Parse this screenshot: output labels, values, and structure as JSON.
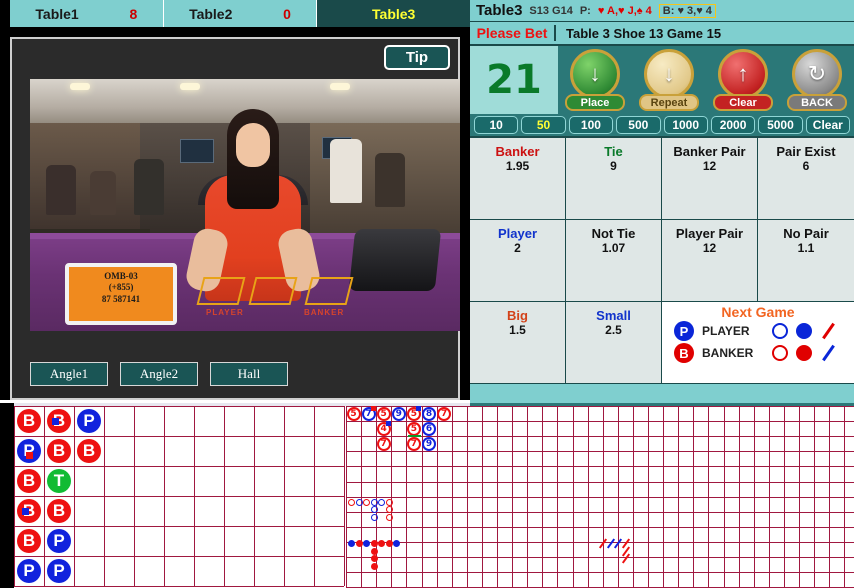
{
  "tabs": [
    {
      "label": "Table1",
      "count": "8",
      "active": false
    },
    {
      "label": "Table2",
      "count": "0",
      "active": false
    },
    {
      "label": "Table3",
      "count": "",
      "active": true
    }
  ],
  "video": {
    "tip_label": "Tip",
    "sign_line1": "OMB-03",
    "sign_line2": "(+855)",
    "sign_line3": "87 587141",
    "label_player": "PLAYER",
    "label_banker": "BANKER",
    "buttons": [
      {
        "label": "Angle1"
      },
      {
        "label": "Angle2"
      },
      {
        "label": "Hall"
      }
    ]
  },
  "header": {
    "title": "Table3",
    "shoe_game": "S13 G14",
    "player_cards_label": "P:",
    "player_cards": "♥ A,♥ J,♠ 4",
    "banker_cards": "B: ♥ 3,♥ 4",
    "status": "Please Bet",
    "game_info": "Table 3  Shoe 13  Game 15"
  },
  "action": {
    "countdown": "21",
    "buttons": [
      {
        "label": "Place",
        "icon": "down-arrow-chip-icon",
        "color": "#2f8a34"
      },
      {
        "label": "Repeat",
        "icon": "repeat-chip-icon",
        "color": "#e0c585"
      },
      {
        "label": "Clear",
        "icon": "up-arrow-chip-icon",
        "color": "#c32222"
      },
      {
        "label": "BACK",
        "icon": "refresh-icon",
        "color": "#7a7a7a"
      }
    ]
  },
  "chips": {
    "selected": "50",
    "values": [
      "10",
      "50",
      "100",
      "500",
      "1000",
      "2000",
      "5000",
      "Clear"
    ]
  },
  "bets": [
    {
      "name": "Banker",
      "odds": "1.95",
      "color_class": "c-banker"
    },
    {
      "name": "Tie",
      "odds": "9",
      "color_class": "c-tie"
    },
    {
      "name": "Banker Pair",
      "odds": "12",
      "color_class": "c-dark"
    },
    {
      "name": "Pair Exist",
      "odds": "6",
      "color_class": "c-dark"
    },
    {
      "name": "Player",
      "odds": "2",
      "color_class": "c-player"
    },
    {
      "name": "Not Tie",
      "odds": "1.07",
      "color_class": "c-dark"
    },
    {
      "name": "Player Pair",
      "odds": "12",
      "color_class": "c-dark"
    },
    {
      "name": "No Pair",
      "odds": "1.1",
      "color_class": "c-dark"
    },
    {
      "name": "Big",
      "odds": "1.5",
      "color_class": "c-big"
    },
    {
      "name": "Small",
      "odds": "2.5",
      "color_class": "c-small"
    }
  ],
  "next_game": {
    "title": "Next Game",
    "rows": [
      {
        "bead": "P",
        "name": "PLAYER",
        "ring": "blue",
        "dot": "blue",
        "slash": "red"
      },
      {
        "bead": "B",
        "name": "BANKER",
        "ring": "red",
        "dot": "red",
        "slash": "blue"
      }
    ]
  },
  "roads": {
    "bead_plate": {
      "cols": 6,
      "rows": 6,
      "cell": 30,
      "entries": [
        {
          "c": 0,
          "r": 0,
          "v": "B"
        },
        {
          "c": 1,
          "r": 0,
          "v": "B",
          "pair": "blue"
        },
        {
          "c": 2,
          "r": 0,
          "v": "P"
        },
        {
          "c": 0,
          "r": 1,
          "v": "P",
          "pair": "red"
        },
        {
          "c": 1,
          "r": 1,
          "v": "B"
        },
        {
          "c": 2,
          "r": 1,
          "v": "B"
        },
        {
          "c": 0,
          "r": 2,
          "v": "B"
        },
        {
          "c": 1,
          "r": 2,
          "v": "T"
        },
        {
          "c": 0,
          "r": 3,
          "v": "B",
          "pair": "blue"
        },
        {
          "c": 1,
          "r": 3,
          "v": "B"
        },
        {
          "c": 0,
          "r": 4,
          "v": "B"
        },
        {
          "c": 1,
          "r": 4,
          "v": "P"
        },
        {
          "c": 0,
          "r": 5,
          "v": "P"
        },
        {
          "c": 1,
          "r": 5,
          "v": "P"
        }
      ]
    },
    "big_road": {
      "entries": [
        {
          "c": 0,
          "r": 0,
          "v": "5",
          "side": "red"
        },
        {
          "c": 1,
          "r": 0,
          "v": "7",
          "side": "blue",
          "pair": "red"
        },
        {
          "c": 2,
          "r": 0,
          "v": "5",
          "side": "red"
        },
        {
          "c": 2,
          "r": 1,
          "v": "4",
          "side": "red",
          "pair": "blue"
        },
        {
          "c": 2,
          "r": 2,
          "v": "7",
          "side": "red"
        },
        {
          "c": 3,
          "r": 0,
          "v": "9",
          "side": "blue"
        },
        {
          "c": 4,
          "r": 0,
          "v": "5",
          "side": "red",
          "pair": "blue"
        },
        {
          "c": 4,
          "r": 1,
          "v": "5",
          "side": "red",
          "tie": true
        },
        {
          "c": 4,
          "r": 2,
          "v": "7",
          "side": "red"
        },
        {
          "c": 5,
          "r": 0,
          "v": "8",
          "side": "blue"
        },
        {
          "c": 5,
          "r": 1,
          "v": "6",
          "side": "blue"
        },
        {
          "c": 5,
          "r": 2,
          "v": "9",
          "side": "blue"
        },
        {
          "c": 6,
          "r": 0,
          "v": "7",
          "side": "red"
        }
      ]
    },
    "big_eye_boy": {
      "entries": [
        {
          "c": 0,
          "r": 0,
          "side": "red"
        },
        {
          "c": 1,
          "r": 0,
          "side": "blue"
        },
        {
          "c": 2,
          "r": 0,
          "side": "red"
        },
        {
          "c": 3,
          "r": 0,
          "side": "blue"
        },
        {
          "c": 3,
          "r": 1,
          "side": "blue"
        },
        {
          "c": 3,
          "r": 2,
          "side": "blue"
        },
        {
          "c": 4,
          "r": 0,
          "side": "blue"
        },
        {
          "c": 5,
          "r": 0,
          "side": "red"
        },
        {
          "c": 5,
          "r": 1,
          "side": "red"
        },
        {
          "c": 5,
          "r": 2,
          "side": "red"
        }
      ]
    },
    "small_road": {
      "entries": [
        {
          "c": 0,
          "r": 0,
          "side": "blue"
        },
        {
          "c": 1,
          "r": 0,
          "side": "red"
        },
        {
          "c": 2,
          "r": 0,
          "side": "blue"
        },
        {
          "c": 3,
          "r": 0,
          "side": "red"
        },
        {
          "c": 3,
          "r": 1,
          "side": "red"
        },
        {
          "c": 3,
          "r": 2,
          "side": "red"
        },
        {
          "c": 3,
          "r": 3,
          "side": "red"
        },
        {
          "c": 4,
          "r": 0,
          "side": "red"
        },
        {
          "c": 5,
          "r": 0,
          "side": "red"
        },
        {
          "c": 6,
          "r": 0,
          "side": "blue"
        }
      ]
    },
    "cockroach_pig": {
      "entries": [
        {
          "c": 0,
          "r": 0,
          "side": "red"
        },
        {
          "c": 1,
          "r": 0,
          "side": "blue"
        },
        {
          "c": 2,
          "r": 0,
          "side": "blue"
        },
        {
          "c": 3,
          "r": 0,
          "side": "red"
        },
        {
          "c": 3,
          "r": 1,
          "side": "red"
        },
        {
          "c": 3,
          "r": 2,
          "side": "red"
        }
      ]
    }
  }
}
